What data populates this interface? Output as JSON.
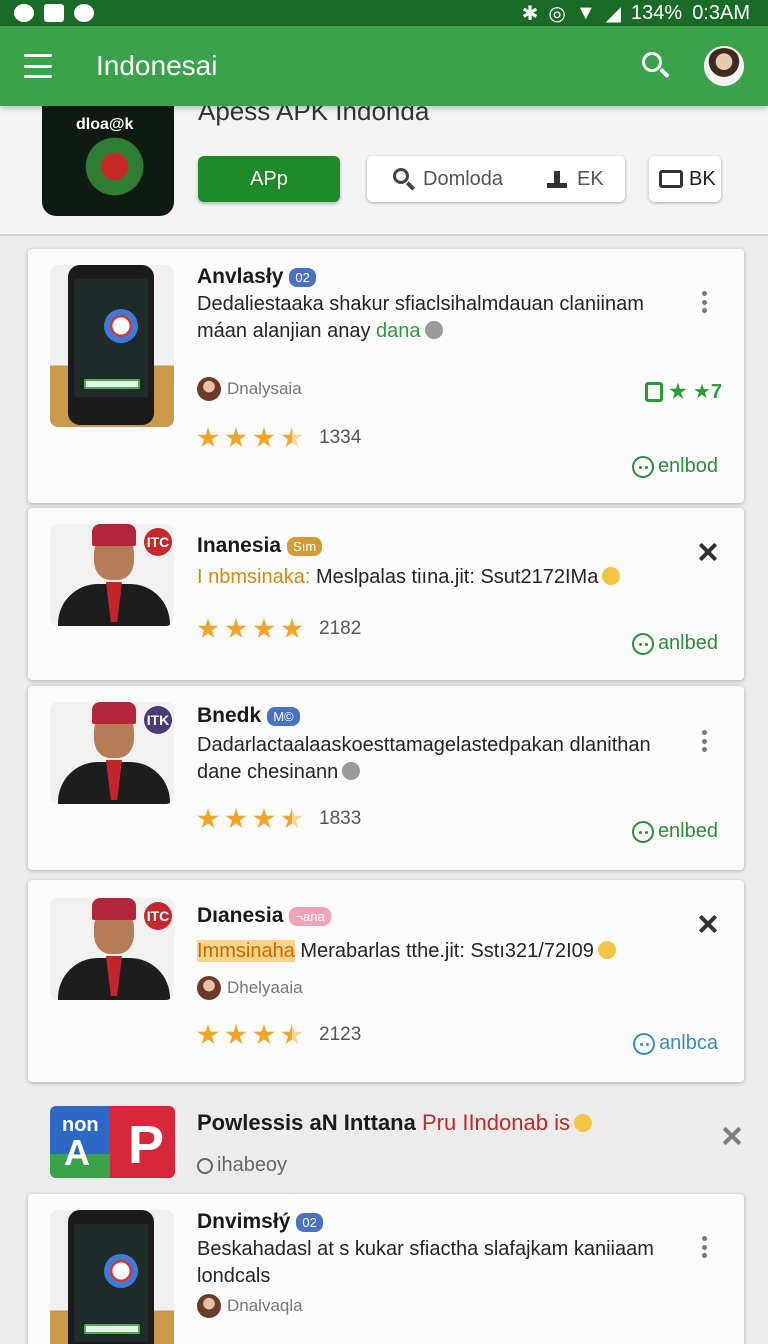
{
  "status_bar": {
    "battery": "134%",
    "time": "0:3AM"
  },
  "app_bar": {
    "title": "Indonesai"
  },
  "hero": {
    "icon_label": "dloa@k",
    "heading": "Apess APK Indonda",
    "primary_button": "APp",
    "download_button": "Domloda",
    "ek_label": "EK",
    "bk_button": "BK"
  },
  "cards": [
    {
      "title": "Anvlasły",
      "tag": "02",
      "desc": "Dedaliestaaka shakur sfiaclsihalmdauan claniinam máan alanjian anay",
      "desc_green": "dana",
      "author": "Dnalysaia",
      "rating_count": "1334",
      "promo": "★7",
      "action": "enlbod"
    },
    {
      "title": "Inanesia",
      "tag": "Sım",
      "desc_prefix": "I nbmsinaka:",
      "desc": "Meslpalas tiına.jit: Ssut2172IMa",
      "rating_count": "2182",
      "badge": "ITC",
      "action": "anlbed"
    },
    {
      "title": "Bnedk",
      "tag": "M©",
      "desc": "Dadarlactaalaaskoesttamagelastedpakan dlanithan dane chesinann",
      "rating_count": "1833",
      "badge": "ITK",
      "action": "enlbed"
    },
    {
      "title": "Dıanesia",
      "tag": "¬ana",
      "desc_prefix": "Immsinaha",
      "desc": "Merabarlas tthe.jit: Sstı321/72I09",
      "author": "Dhelyaaia",
      "rating_count": "2123",
      "badge": "ITC",
      "action": "anlbca"
    },
    {
      "title": "Dnvimsłý",
      "tag": "02",
      "desc": "Beskahadasl at s kukar sfiactha slafajkam kaniiaam londcals",
      "author": "Dnalvaqla"
    }
  ],
  "ad": {
    "icon_top": "non",
    "icon_a": "A",
    "icon_p": "P",
    "title": "Powlessis aN Inttana",
    "title_red": "Pru IIndonab is",
    "subtitle": "ihabeoy"
  },
  "colors": {
    "app_bar": "#3aa34a",
    "status_bar": "#1a6b28",
    "primary_button": "#1e8a2a",
    "star": "#f0a42a",
    "action_green": "#2e8b3a",
    "action_blue": "#3a8ac7"
  }
}
